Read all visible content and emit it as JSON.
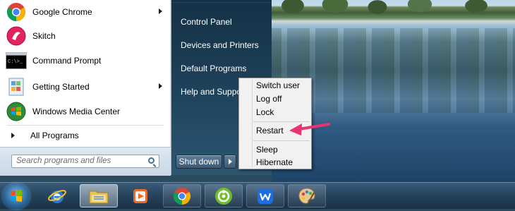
{
  "start_menu": {
    "programs": [
      {
        "label": "Google Chrome",
        "icon": "chrome-icon",
        "has_submenu": true
      },
      {
        "label": "Skitch",
        "icon": "skitch-icon",
        "has_submenu": false
      },
      {
        "label": "Command Prompt",
        "icon": "command-prompt-icon",
        "has_submenu": false
      },
      {
        "label": "Getting Started",
        "icon": "getting-started-icon",
        "has_submenu": true
      },
      {
        "label": "Windows Media Center",
        "icon": "windows-media-center-icon",
        "has_submenu": false
      }
    ],
    "all_programs_label": "All Programs",
    "search_placeholder": "Search programs and files",
    "right_items": [
      {
        "label": "Control Panel"
      },
      {
        "label": "Devices and Printers"
      },
      {
        "label": "Default Programs"
      },
      {
        "label": "Help and Support"
      }
    ],
    "shutdown_label": "Shut down"
  },
  "shutdown_submenu": {
    "items": [
      "Switch user",
      "Log off",
      "Lock",
      "Restart",
      "Sleep",
      "Hibernate"
    ],
    "highlighted": "Restart"
  },
  "annotation": {
    "arrow_color": "#e8336e"
  },
  "taskbar": {
    "items": [
      {
        "name": "internet-explorer",
        "icon": "internet-explorer-icon"
      },
      {
        "name": "windows-explorer",
        "icon": "folder-icon"
      },
      {
        "name": "media-player",
        "icon": "media-player-icon"
      },
      {
        "name": "google-chrome",
        "icon": "chrome-icon"
      },
      {
        "name": "greenshot",
        "icon": "camera-shot-icon"
      },
      {
        "name": "wps-office",
        "icon": "wps-office-icon"
      },
      {
        "name": "paint",
        "icon": "paint-palette-icon"
      }
    ]
  }
}
